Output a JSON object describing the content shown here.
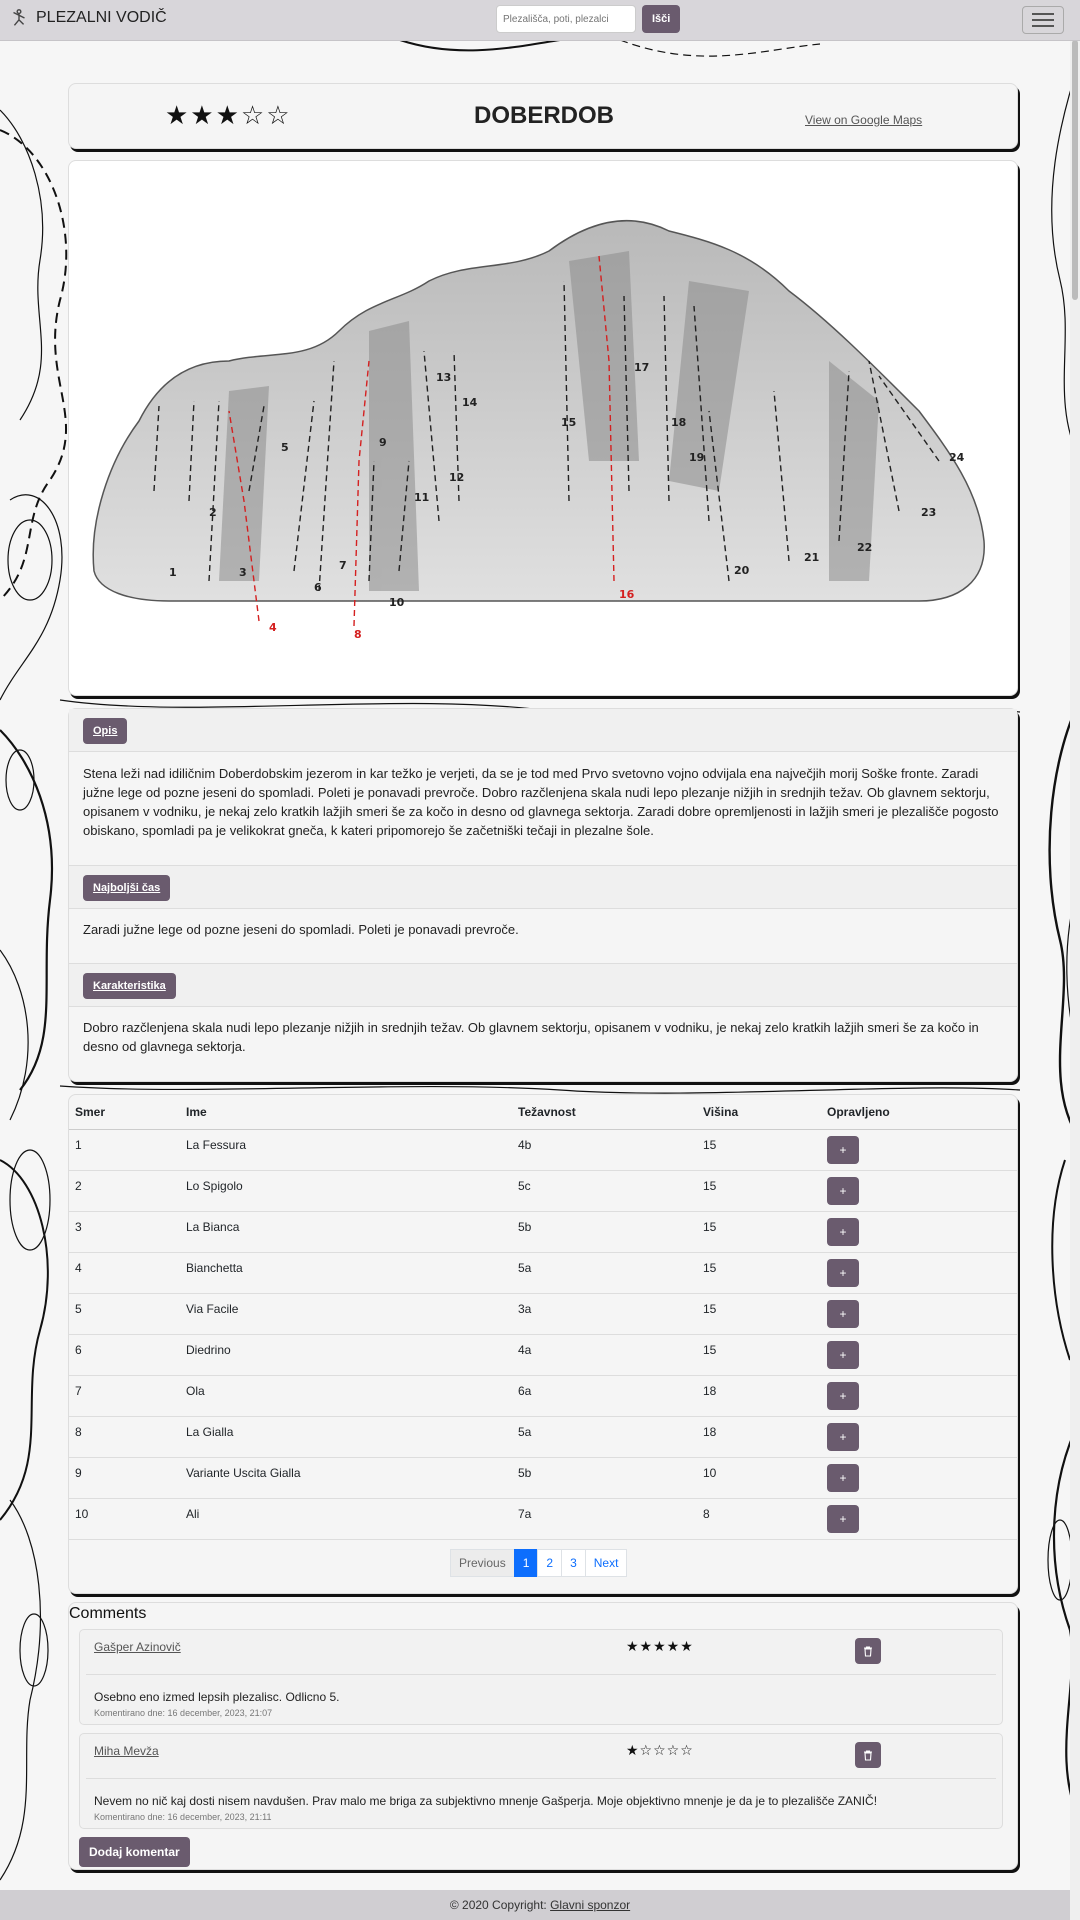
{
  "navbar": {
    "brand": "PLEZALNI VODIČ",
    "search_placeholder": "Plezališča, poti, plezalci",
    "search_button": "Išči"
  },
  "crag": {
    "name": "DOBERDOB",
    "rating_stars": "★★★☆☆",
    "rating_value": 3,
    "maps_link": "View on Google Maps"
  },
  "topo": {
    "route_numbers": [
      "1",
      "2",
      "3",
      "4",
      "5",
      "6",
      "7",
      "8",
      "9",
      "10",
      "11",
      "12",
      "13",
      "14",
      "15",
      "16",
      "17",
      "18",
      "19",
      "20",
      "21",
      "22",
      "23",
      "24"
    ],
    "highlighted": [
      "4",
      "8",
      "16"
    ]
  },
  "sections": [
    {
      "title": "Opis",
      "body": "Stena leži nad idiličnim Doberdobskim jezerom in kar težko je verjeti, da se je tod med Prvo svetovno vojno odvijala ena največjih morij Soške fronte. Zaradi južne lege od pozne jeseni do spomladi. Poleti je ponavadi prevroče. Dobro razčlenjena skala nudi lepo plezanje nižjih in srednjih težav. Ob glavnem sektorju, opisanem v vodniku, je nekaj zelo kratkih lažjih smeri še za kočo in desno od glavnega sektorja. Zaradi dobre opremljenosti in lažjih smeri je plezališče pogosto obiskano, spomladi pa je velikokrat gneča, k kateri pripomorejo še začetniški tečaji in plezalne šole."
    },
    {
      "title": "Najboljši čas",
      "body": "Zaradi južne lege od pozne jeseni do spomladi. Poleti je ponavadi prevroče."
    },
    {
      "title": "Karakteristika",
      "body": "Dobro razčlenjena skala nudi lepo plezanje nižjih in srednjih težav. Ob glavnem sektorju, opisanem v vodniku, je nekaj zelo kratkih lažjih smeri še za kočo in desno od glavnega sektorja."
    }
  ],
  "routes_table": {
    "headers": [
      "Smer",
      "Ime",
      "Težavnost",
      "Višina",
      "Opravljeno"
    ],
    "add_label": "+",
    "rows": [
      {
        "smer": "1",
        "ime": "La Fessura",
        "tez": "4b",
        "visina": "15"
      },
      {
        "smer": "2",
        "ime": "Lo Spigolo",
        "tez": "5c",
        "visina": "15"
      },
      {
        "smer": "3",
        "ime": "La Bianca",
        "tez": "5b",
        "visina": "15"
      },
      {
        "smer": "4",
        "ime": "Bianchetta",
        "tez": "5a",
        "visina": "15"
      },
      {
        "smer": "5",
        "ime": "Via Facile",
        "tez": "3a",
        "visina": "15"
      },
      {
        "smer": "6",
        "ime": "Diedrino",
        "tez": "4a",
        "visina": "15"
      },
      {
        "smer": "7",
        "ime": "Ola",
        "tez": "6a",
        "visina": "18"
      },
      {
        "smer": "8",
        "ime": "La Gialla",
        "tez": "5a",
        "visina": "18"
      },
      {
        "smer": "9",
        "ime": "Variante Uscita Gialla",
        "tez": "5b",
        "visina": "10"
      },
      {
        "smer": "10",
        "ime": "Ali",
        "tez": "7a",
        "visina": "8"
      }
    ]
  },
  "pagination": {
    "previous": "Previous",
    "pages": [
      "1",
      "2",
      "3"
    ],
    "active": "1",
    "next": "Next"
  },
  "comments": {
    "title": "Comments",
    "items": [
      {
        "author": "Gašper Azinovič",
        "stars": "★★★★★",
        "rating": 5,
        "text": "Osebno eno izmed lepsih plezalisc. Odlicno 5.",
        "date": "Komentirano dne: 16 december, 2023, 21:07"
      },
      {
        "author": "Miha Mevža",
        "stars": "★☆☆☆☆",
        "rating": 1,
        "text": "Nevem no nič kaj dosti nisem navdušen. Prav malo me briga za subjektivno mnenje Gašperja. Moje objektivno mnenje je da je to plezališče ZANIČ!",
        "date": "Komentirano dne: 16 december, 2023, 21:11"
      }
    ],
    "add_button": "Dodaj komentar"
  },
  "footer": {
    "copyright": "© 2020 Copyright:",
    "link": "Glavni sponzor"
  },
  "colors": {
    "accent": "#6a5b6e",
    "navbar": "#d8d6da",
    "page_active": "#0d6efd",
    "route_highlight": "#d42020"
  }
}
